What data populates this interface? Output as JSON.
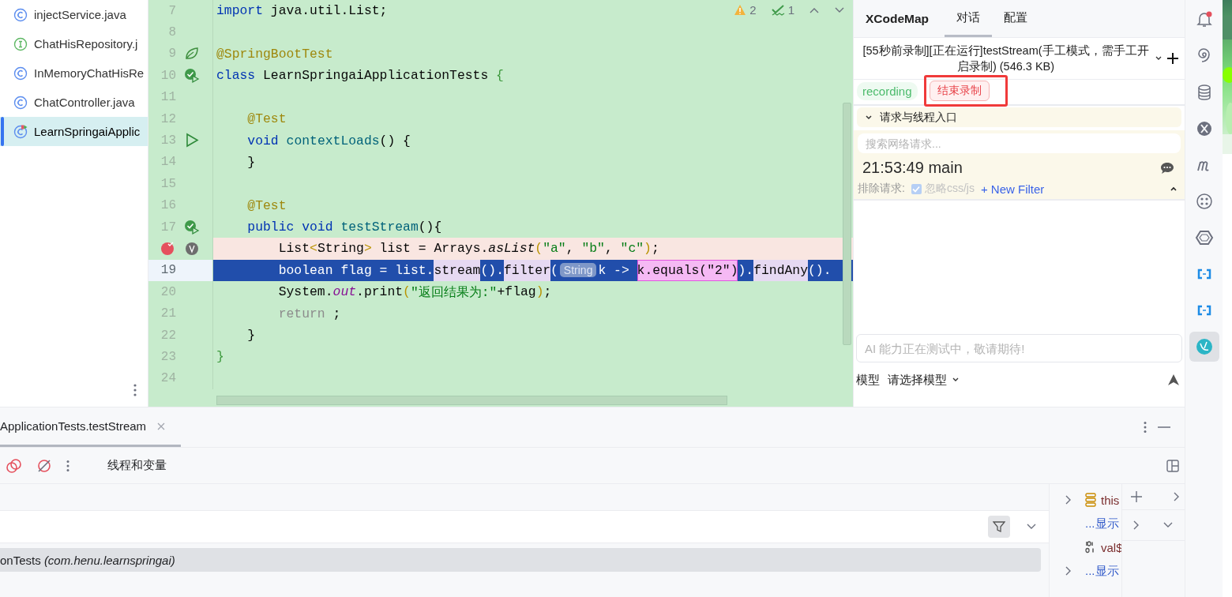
{
  "project_tree": {
    "items": [
      {
        "name": "injectService.java",
        "kind": "class",
        "selected": false
      },
      {
        "name": "ChatHisRepository.j",
        "kind": "interface",
        "selected": false
      },
      {
        "name": "InMemoryChatHisRe",
        "kind": "class",
        "selected": false
      },
      {
        "name": "ChatController.java",
        "kind": "class",
        "selected": false
      },
      {
        "name": "LearnSpringaiApplic",
        "kind": "test_class",
        "selected": true
      }
    ]
  },
  "editor": {
    "inspections": {
      "warnings": "2",
      "checks": "1"
    },
    "lines": [
      {
        "number": "7",
        "kind": "normal",
        "tokens": [
          {
            "kind": "kw",
            "text": "import"
          },
          {
            "kind": "plain",
            "text": " java.util.List;"
          }
        ]
      },
      {
        "number": "8",
        "kind": "normal"
      },
      {
        "number": "9",
        "kind": "normal",
        "gutter": {
          "kind": "leaf"
        },
        "tokens": [
          {
            "kind": "ann",
            "text": "@SpringBootTest"
          }
        ]
      },
      {
        "number": "10",
        "kind": "normal",
        "gutter": {
          "kind": "test_passed"
        },
        "tokens": [
          {
            "kind": "kw",
            "text": "class"
          },
          {
            "kind": "plain",
            "text": " LearnSpringaiApplicationTests "
          },
          {
            "kind": "brace",
            "text": "{"
          }
        ]
      },
      {
        "number": "11",
        "kind": "normal"
      },
      {
        "number": "12",
        "kind": "normal",
        "tokens": [
          {
            "kind": "ann",
            "text": "    @Test"
          }
        ]
      },
      {
        "number": "13",
        "kind": "normal",
        "gutter": {
          "kind": "run"
        },
        "tokens": [
          {
            "kind": "kw",
            "text": "    void"
          },
          {
            "kind": "fn",
            "text": " contextLoads"
          },
          {
            "kind": "plain",
            "text": "() {"
          }
        ]
      },
      {
        "number": "14",
        "kind": "normal",
        "tokens": [
          {
            "kind": "plain",
            "text": "    }"
          }
        ]
      },
      {
        "number": "15",
        "kind": "normal"
      },
      {
        "number": "16",
        "kind": "normal",
        "tokens": [
          {
            "kind": "ann",
            "text": "    @Test"
          }
        ]
      },
      {
        "number": "17",
        "kind": "normal",
        "gutter": {
          "kind": "test_passed"
        },
        "tokens": [
          {
            "kind": "kw",
            "text": "    public void"
          },
          {
            "kind": "fn",
            "text": " testStream"
          },
          {
            "kind": "plain",
            "text": "(){"
          }
        ]
      },
      {
        "kind": "breakpoint",
        "gutter": {
          "kind": "breakpoint"
        },
        "tokens": [
          {
            "kind": "plain",
            "text": "        List"
          },
          {
            "kind": "generic",
            "text": "<"
          },
          {
            "kind": "plain",
            "text": "String"
          },
          {
            "kind": "generic",
            "text": ">"
          },
          {
            "kind": "plain",
            "text": " list = Arrays."
          },
          {
            "kind": "italic",
            "text": "asList"
          },
          {
            "kind": "generic",
            "text": "("
          },
          {
            "kind": "str",
            "text": "\"a\""
          },
          {
            "kind": "plain",
            "text": ", "
          },
          {
            "kind": "str",
            "text": "\"b\""
          },
          {
            "kind": "plain",
            "text": ", "
          },
          {
            "kind": "str",
            "text": "\"c\""
          },
          {
            "kind": "generic",
            "text": ")"
          },
          {
            "kind": "plain",
            "text": ";"
          }
        ]
      },
      {
        "number": "19",
        "kind": "current",
        "tokens": [
          {
            "kind": "sel",
            "text": "        boolean flag = list."
          },
          {
            "kind": "hl",
            "text": "stream"
          },
          {
            "kind": "sel",
            "text": "()."
          },
          {
            "kind": "hl",
            "text": "filter"
          },
          {
            "kind": "sel",
            "text": "("
          },
          {
            "kind": "hint",
            "text": "String"
          },
          {
            "kind": "sel",
            "text": "k -> "
          },
          {
            "kind": "pink",
            "text": "k.equals(\"2\")"
          },
          {
            "kind": "sel",
            "text": ")."
          },
          {
            "kind": "hl",
            "text": "findAny"
          },
          {
            "kind": "sel",
            "text": "()."
          }
        ]
      },
      {
        "number": "20",
        "kind": "normal",
        "tokens": [
          {
            "kind": "plain",
            "text": "        System."
          },
          {
            "kind": "field",
            "text": "out"
          },
          {
            "kind": "plain",
            "text": ".print"
          },
          {
            "kind": "generic",
            "text": "("
          },
          {
            "kind": "str",
            "text": "\"返回结果为:\""
          },
          {
            "kind": "plain",
            "text": "+flag"
          },
          {
            "kind": "generic",
            "text": ")"
          },
          {
            "kind": "plain",
            "text": ";"
          }
        ]
      },
      {
        "number": "21",
        "kind": "normal",
        "tokens": [
          {
            "kind": "muted",
            "text": "        return"
          },
          {
            "kind": "plain",
            "text": " ;"
          }
        ]
      },
      {
        "number": "22",
        "kind": "normal",
        "tokens": [
          {
            "kind": "plain",
            "text": "    }"
          }
        ]
      },
      {
        "number": "23",
        "kind": "normal",
        "tokens": [
          {
            "kind": "brace",
            "text": "}"
          }
        ]
      },
      {
        "number": "24",
        "kind": "normal"
      }
    ]
  },
  "xcodemap": {
    "title": "XCodeMap",
    "tabs": [
      {
        "label": "对话",
        "selected": true
      },
      {
        "label": "配置",
        "selected": false
      }
    ],
    "session": "[55秒前录制][正在运行]testStream(手工模式，需手工开启录制) (546.3 KB)",
    "status": "recording",
    "stop_button": "结束录制",
    "section": {
      "title": "请求与线程入口",
      "expanded": true
    },
    "search": {
      "placeholder": "搜索网络请求..."
    },
    "thread": "21:53:49 main",
    "exclude": {
      "label": "排除请求:",
      "checkbox": {
        "label": "忽略css/js",
        "checked": true
      },
      "new_filter": "+ New Filter"
    },
    "chat_input": {
      "placeholder": "AI 能力正在测试中，敬请期待!"
    },
    "model": {
      "label": "模型",
      "value": "请选择模型"
    }
  },
  "tool_strip": {
    "items": [
      {
        "kind": "bell",
        "selected": false
      },
      {
        "kind": "swirl",
        "selected": false
      },
      {
        "kind": "database",
        "selected": false
      },
      {
        "kind": "x_circle",
        "selected": false
      },
      {
        "kind": "m",
        "selected": false
      },
      {
        "kind": "dots",
        "selected": false
      },
      {
        "kind": "hexagon",
        "selected": false
      },
      {
        "kind": "link",
        "selected": false
      },
      {
        "kind": "link",
        "selected": false
      },
      {
        "kind": "app",
        "selected": true
      }
    ]
  },
  "debug": {
    "tab": {
      "label": "ApplicationTests.testStream",
      "selected": true
    },
    "toolbar_title": "线程和变量",
    "frames": [
      {
        "name": "onTests",
        "package": "(com.henu.learnspringai)",
        "selected": true
      }
    ],
    "variables": [
      {
        "kind": "object",
        "name": "this",
        "expandable": true
      },
      {
        "kind": "link",
        "name": "...显示",
        "expandable": false
      },
      {
        "kind": "primitive",
        "name": "val$",
        "expandable": false
      },
      {
        "kind": "link",
        "name": "...显示",
        "expandable": true
      }
    ]
  }
}
